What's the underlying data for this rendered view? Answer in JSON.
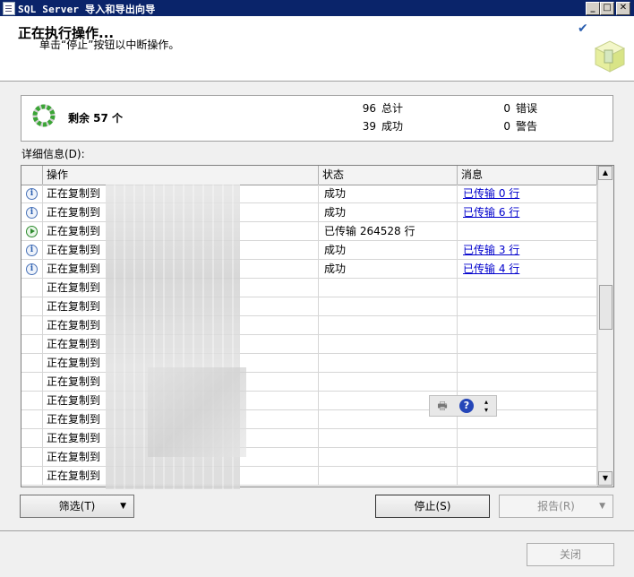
{
  "window": {
    "title": "SQL Server 导入和导出向导",
    "controls": [
      "_",
      "□",
      "✕"
    ]
  },
  "header": {
    "title": "正在执行操作...",
    "subtitle": "单击“停止”按钮以中断操作。"
  },
  "progress": {
    "remaining": "剩余 57 个",
    "total_num": "96",
    "total_label": "总计",
    "success_num": "39",
    "success_label": "成功",
    "error_num": "0",
    "error_label": "错误",
    "warning_num": "0",
    "warning_label": "警告"
  },
  "details_label": "详细信息(D):",
  "grid": {
    "columns": [
      "操作",
      "状态",
      "消息"
    ],
    "rows": [
      {
        "icon": "info",
        "action": "正在复制到",
        "status": "成功",
        "message": "已传输 0 行"
      },
      {
        "icon": "info",
        "action": "正在复制到",
        "status": "成功",
        "message": "已传输 6 行"
      },
      {
        "icon": "running",
        "action": "正在复制到",
        "status": "已传输 264528 行",
        "message": ""
      },
      {
        "icon": "info",
        "action": "正在复制到",
        "status": "成功",
        "message": "已传输 3 行"
      },
      {
        "icon": "info",
        "action": "正在复制到",
        "status": "成功",
        "message": "已传输 4 行"
      },
      {
        "icon": "",
        "action": "正在复制到",
        "status": "",
        "message": ""
      },
      {
        "icon": "",
        "action": "正在复制到",
        "status": "",
        "message": ""
      },
      {
        "icon": "",
        "action": "正在复制到",
        "status": "",
        "message": ""
      },
      {
        "icon": "",
        "action": "正在复制到",
        "status": "",
        "message": ""
      },
      {
        "icon": "",
        "action": "正在复制到",
        "status": "",
        "message": ""
      },
      {
        "icon": "",
        "action": "正在复制到",
        "status": "",
        "message": ""
      },
      {
        "icon": "",
        "action": "正在复制到",
        "status": "",
        "message": ""
      },
      {
        "icon": "",
        "action": "正在复制到",
        "status": "",
        "message": ""
      },
      {
        "icon": "",
        "action": "正在复制到",
        "status": "",
        "message": ""
      },
      {
        "icon": "",
        "action": "正在复制到",
        "status": "",
        "message": ""
      },
      {
        "icon": "",
        "action": "正在复制到",
        "status": "",
        "message": ""
      }
    ]
  },
  "buttons": {
    "filter": "筛选(T)",
    "stop": "停止(S)",
    "report": "报告(R)",
    "close": "关闭"
  },
  "colors": {
    "titlebar": "#0a246a",
    "link": "#0000cc"
  }
}
